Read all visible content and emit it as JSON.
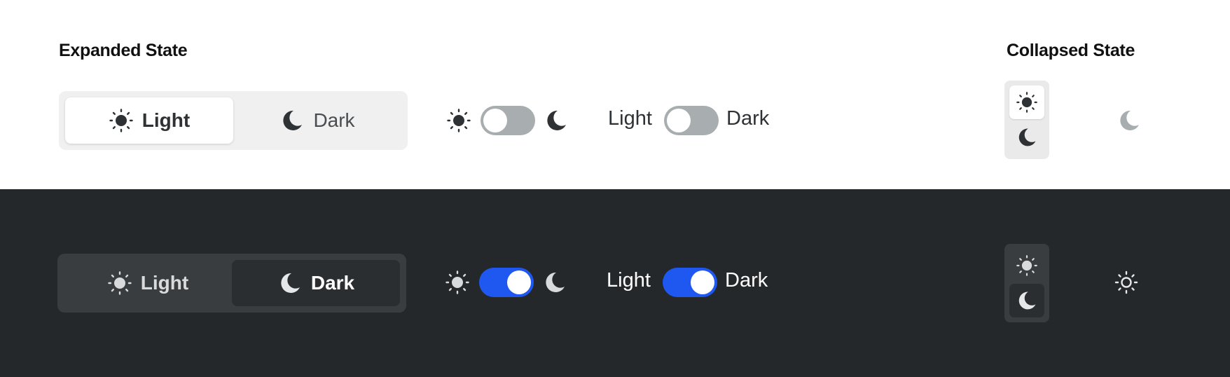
{
  "expanded_heading": "Expanded State",
  "collapsed_heading": "Collapsed State",
  "light_theme": {
    "segmented": {
      "light_label": "Light",
      "dark_label": "Dark",
      "selected": "Light"
    },
    "icon_toggle": {
      "left_icon": "sun-icon",
      "right_icon": "moon-icon",
      "on": false
    },
    "text_toggle": {
      "left_label": "Light",
      "right_label": "Dark",
      "on": false
    },
    "collapsed_stack": {
      "top_icon": "sun-icon",
      "bottom_icon": "moon-icon",
      "selected": "sun"
    },
    "collapsed_single": {
      "icon": "moon-icon"
    }
  },
  "dark_theme": {
    "segmented": {
      "light_label": "Light",
      "dark_label": "Dark",
      "selected": "Dark"
    },
    "icon_toggle": {
      "left_icon": "sun-icon",
      "right_icon": "moon-icon",
      "on": true
    },
    "text_toggle": {
      "left_label": "Light",
      "right_label": "Dark",
      "on": true
    },
    "collapsed_stack": {
      "top_icon": "sun-icon",
      "bottom_icon": "moon-icon",
      "selected": "moon"
    },
    "collapsed_single": {
      "icon": "sun-icon"
    }
  },
  "colors": {
    "accent": "#1e58f0",
    "dark_background": "#25282a",
    "light_control_bg": "#f0f0f0",
    "dark_control_bg": "#3a3d40",
    "toggle_off": "#a8adb0"
  }
}
